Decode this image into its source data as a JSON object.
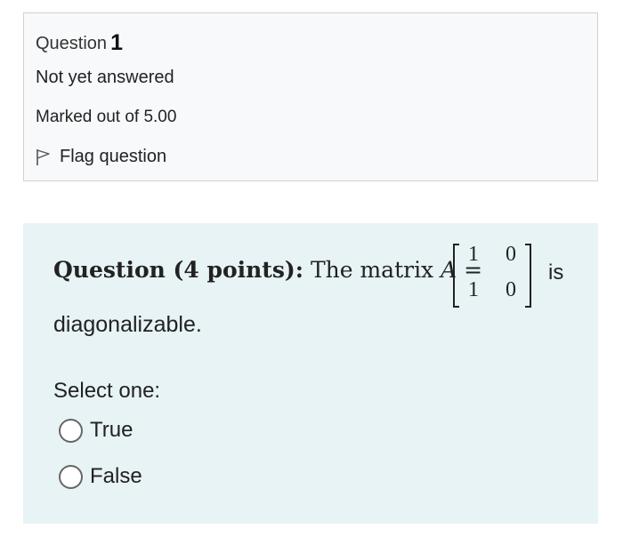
{
  "info": {
    "question_label": "Question",
    "question_number": "1",
    "state": "Not yet answered",
    "grade": "Marked out of 5.00",
    "flag_label": "Flag question"
  },
  "question": {
    "heading": "Question (4 points):",
    "text_before": "The matrix",
    "matrix_var": "A",
    "equals": "=",
    "matrix": [
      [
        "1",
        "0"
      ],
      [
        "1",
        "0"
      ]
    ],
    "text_after": "is",
    "text_continued": "diagonalizable.",
    "prompt": "Select one:",
    "options": [
      "True",
      "False"
    ]
  },
  "icons": {
    "flag": "flag-outline-icon"
  }
}
